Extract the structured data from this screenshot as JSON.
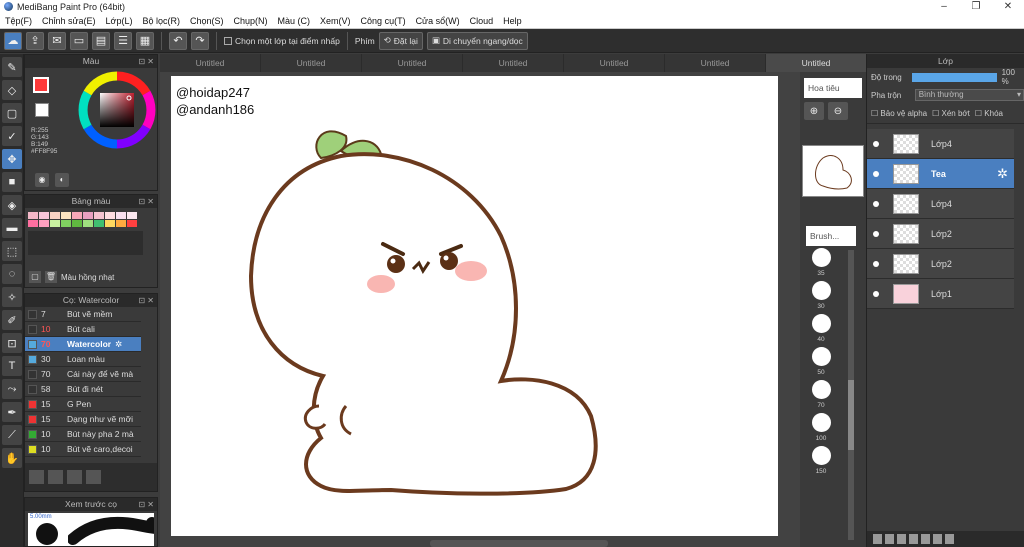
{
  "window": {
    "title": "MediBang Paint Pro (64bit)",
    "minimize": "–",
    "maximize": "❐",
    "close": "✕"
  },
  "menu": [
    "Tệp(F)",
    "Chỉnh sửa(E)",
    "Lớp(L)",
    "Bộ lọc(R)",
    "Chọn(S)",
    "Chụp(N)",
    "Màu (C)",
    "Xem(V)",
    "Công cụ(T)",
    "Cửa sổ(W)",
    "Cloud",
    "Help"
  ],
  "toolbar": {
    "select_layer_label": "Chọn một lớp tại điểm nhấp",
    "key_label": "Phím",
    "reset_label": "Đặt lại",
    "move_label": "Di chuyển ngang/dọc"
  },
  "color_panel": {
    "title": "Màu",
    "r": "R:255",
    "g": "G:143",
    "b": "B:149",
    "hex": "#FF8F95",
    "primary": "#FF3A3A"
  },
  "palette_panel": {
    "title": "Bảng màu",
    "selected_name": "Màu hồng nhạt",
    "swatches": [
      "#f4b8c8",
      "#f7c6d9",
      "#f9d3c4",
      "#fbe3c0",
      "#f7a8b8",
      "#e9a0c0",
      "#f5c4d0",
      "#ffdde1",
      "#f9e0ee",
      "#fce8f0",
      "#ff6fa0",
      "#ffa0c0",
      "#c8f0a0",
      "#80d060",
      "#60b840",
      "#a0e080",
      "#40c070",
      "#ffd860",
      "#ffaa40",
      "#ff4040"
    ]
  },
  "brush_panel": {
    "title": "Cọ: Watercolor",
    "brushes": [
      {
        "size": "7",
        "name": "Bút vẽ mềm",
        "color": "#333",
        "red": false
      },
      {
        "size": "10",
        "name": "Bút cali",
        "color": "#333",
        "red": true
      },
      {
        "size": "70",
        "name": "Watercolor",
        "color": "#5ad",
        "red": true
      },
      {
        "size": "30",
        "name": "Loan màu",
        "color": "#5ad",
        "red": false
      },
      {
        "size": "70",
        "name": "Cái này để vẽ mà",
        "color": "#333",
        "red": false
      },
      {
        "size": "58",
        "name": "Bút đi nét",
        "color": "#333",
        "red": false
      },
      {
        "size": "15",
        "name": "G Pen",
        "color": "#e33",
        "red": false
      },
      {
        "size": "15",
        "name": "Dạng như vẽ mỡi",
        "color": "#e33",
        "red": false
      },
      {
        "size": "10",
        "name": "Bút này pha 2 mà",
        "color": "#3a3",
        "red": false
      },
      {
        "size": "10",
        "name": "Bút vẽ caro,decoi",
        "color": "#dd2",
        "red": false
      }
    ]
  },
  "preview_panel": {
    "title": "Xem trước cọ",
    "size": "5.00mm"
  },
  "tabs": [
    "Untitled",
    "Untitled",
    "Untitled",
    "Untitled",
    "Untitled",
    "Untitled",
    "Untitled"
  ],
  "canvas": {
    "watermark1": "@hoidap247",
    "watermark2": "@andanh186"
  },
  "navigator": {
    "title": "Hoa tiêu"
  },
  "brush_size": {
    "title": "Brush...",
    "sizes": [
      "35",
      "30",
      "40",
      "50",
      "70",
      "100",
      "150"
    ]
  },
  "layer_panel": {
    "title": "Lớp",
    "opacity_label": "Độ trong",
    "opacity_value": "100 %",
    "blend_label": "Pha trộn",
    "blend_value": "Bình thường",
    "protect_alpha": "Bảo vệ alpha",
    "clipping": "Xén bớt",
    "lock": "Khóa",
    "layers": [
      {
        "name": "Lớp4",
        "selected": false,
        "pink": false
      },
      {
        "name": "Tea",
        "selected": true,
        "pink": false
      },
      {
        "name": "Lớp4",
        "selected": false,
        "pink": false
      },
      {
        "name": "Lớp2",
        "selected": false,
        "pink": false
      },
      {
        "name": "Lớp2",
        "selected": false,
        "pink": false
      },
      {
        "name": "Lớp1",
        "selected": false,
        "pink": true
      }
    ]
  }
}
